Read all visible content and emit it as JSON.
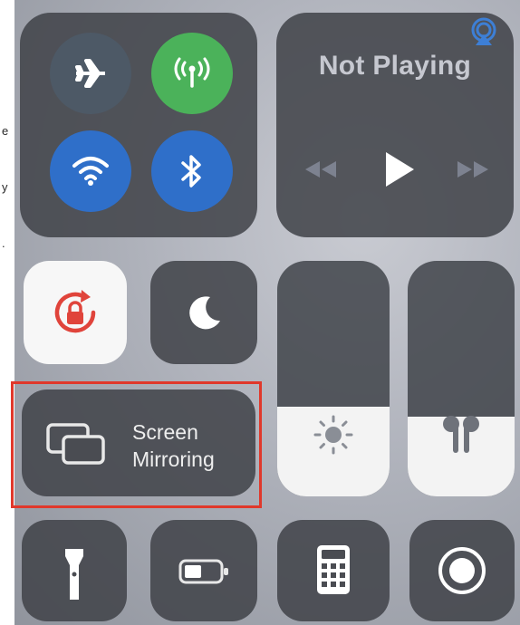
{
  "edge_text": [
    "e",
    "y",
    "."
  ],
  "connectivity": {
    "airplane": {
      "icon": "airplane-icon",
      "active": false,
      "color": "#4d5966"
    },
    "cellular": {
      "icon": "cellular-antenna-icon",
      "active": true,
      "color": "#4bb25a"
    },
    "wifi": {
      "icon": "wifi-icon",
      "active": true,
      "color": "#2f6fc9"
    },
    "bluetooth": {
      "icon": "bluetooth-icon",
      "active": true,
      "color": "#2f6fc9"
    }
  },
  "now_playing": {
    "title": "Not Playing",
    "airplay_icon": "airplay-icon",
    "controls": [
      "rewind-icon",
      "play-icon",
      "fast-forward-icon"
    ]
  },
  "toggles": {
    "orientation_lock": {
      "icon": "orientation-lock-icon",
      "active": true,
      "accent": "#e0443b"
    },
    "do_not_disturb": {
      "icon": "moon-icon",
      "active": false
    }
  },
  "sliders": {
    "brightness": {
      "icon": "sun-icon",
      "level": 0.38
    },
    "volume": {
      "icon": "airpods-icon",
      "level": 0.34
    }
  },
  "screen_mirroring": {
    "icon": "screen-mirroring-icon",
    "line1": "Screen",
    "line2": "Mirroring",
    "highlight_color": "#e0382b"
  },
  "bottom_row": [
    "flashlight-icon",
    "low-power-battery-icon",
    "calculator-icon",
    "screen-record-icon"
  ]
}
